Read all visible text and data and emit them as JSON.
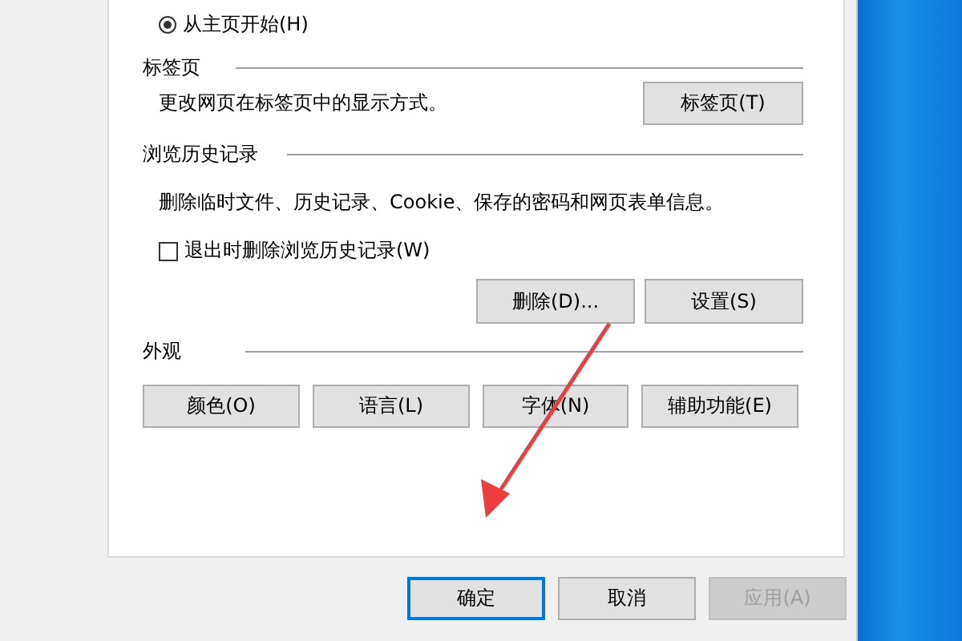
{
  "start_option": {
    "label": "从主页开始(H)",
    "selected": true
  },
  "tabs_section": {
    "title": "标签页",
    "description": "更改网页在标签页中的显示方式。",
    "button": "标签页(T)"
  },
  "history_section": {
    "title": "浏览历史记录",
    "description": "删除临时文件、历史记录、Cookie、保存的密码和网页表单信息。",
    "delete_on_exit": {
      "label": "退出时删除浏览历史记录(W)",
      "checked": false
    },
    "buttons": [
      "删除(D)...",
      "设置(S)"
    ]
  },
  "appearance_section": {
    "title": "外观",
    "buttons": [
      "颜色(O)",
      "语言(L)",
      "字体(N)",
      "辅助功能(E)"
    ]
  },
  "dialog_buttons": [
    {
      "label": "确定",
      "default": true,
      "disabled": false
    },
    {
      "label": "取消",
      "default": false,
      "disabled": false
    },
    {
      "label": "应用(A)",
      "default": false,
      "disabled": true
    }
  ]
}
